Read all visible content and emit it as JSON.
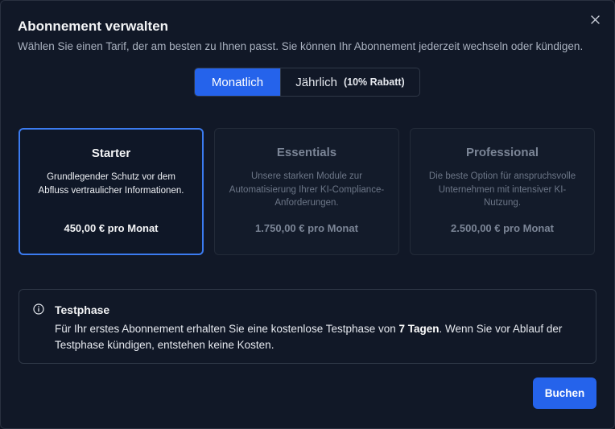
{
  "dialog": {
    "title": "Abonnement verwalten",
    "subtitle": "Wählen Sie einen Tarif, der am besten zu Ihnen passt. Sie können Ihr Abonnement jederzeit wechseln oder kündigen.",
    "close_icon": "close-icon"
  },
  "billing_toggle": {
    "monthly_label": "Monatlich",
    "yearly_label": "Jährlich",
    "yearly_discount": "(10% Rabatt)",
    "selected": "monthly"
  },
  "plans": [
    {
      "name": "Starter",
      "description": "Grundlegender Schutz vor dem Abfluss vertraulicher Informationen.",
      "price": "450,00 € pro Monat",
      "selected": true
    },
    {
      "name": "Essentials",
      "description": "Unsere starken Module zur Automatisierung Ihrer KI-Compliance-Anforderungen.",
      "price": "1.750,00 € pro Monat",
      "selected": false
    },
    {
      "name": "Professional",
      "description": "Die beste Option für anspruchsvolle Unternehmen mit intensiver KI-Nutzung.",
      "price": "2.500,00 € pro Monat",
      "selected": false
    }
  ],
  "trial": {
    "icon": "info-icon",
    "title": "Testphase",
    "text_before": "Für Ihr erstes Abonnement erhalten Sie eine kostenlose Testphase von ",
    "text_bold": "7 Tagen",
    "text_after": ". Wenn Sie vor Ablauf der Testphase kündigen, entstehen keine Kosten."
  },
  "actions": {
    "book_label": "Buchen"
  },
  "colors": {
    "background": "#111827",
    "accent": "#2563eb",
    "selected_border": "#3b7bf0"
  }
}
